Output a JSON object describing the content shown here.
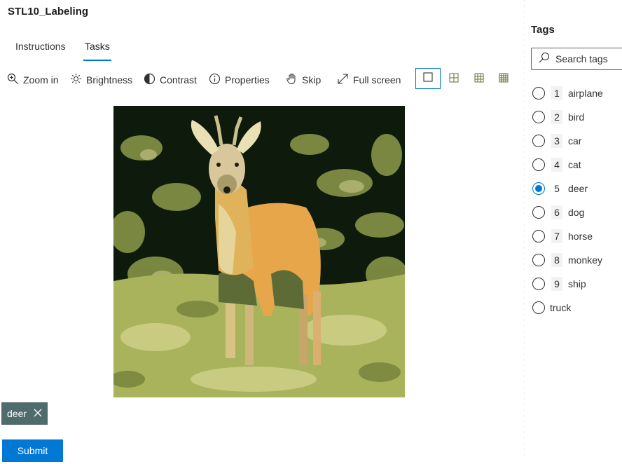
{
  "app": {
    "title": "STL10_Labeling"
  },
  "tabs": [
    {
      "label": "Instructions",
      "active": false
    },
    {
      "label": "Tasks",
      "active": true
    }
  ],
  "toolbar": {
    "zoom_in": "Zoom in",
    "brightness": "Brightness",
    "contrast": "Contrast",
    "properties": "Properties",
    "skip": "Skip",
    "full_screen": "Full screen",
    "grid_options": [
      "single",
      "2x2",
      "3x3",
      "4x4"
    ],
    "grid_selected": "single"
  },
  "image": {
    "subject": "deer"
  },
  "tags_panel": {
    "title": "Tags",
    "search_placeholder": "Search tags",
    "items": [
      {
        "hotkey": "1",
        "label": "airplane",
        "checked": false
      },
      {
        "hotkey": "2",
        "label": "bird",
        "checked": false
      },
      {
        "hotkey": "3",
        "label": "car",
        "checked": false
      },
      {
        "hotkey": "4",
        "label": "cat",
        "checked": false
      },
      {
        "hotkey": "5",
        "label": "deer",
        "checked": true
      },
      {
        "hotkey": "6",
        "label": "dog",
        "checked": false
      },
      {
        "hotkey": "7",
        "label": "horse",
        "checked": false
      },
      {
        "hotkey": "8",
        "label": "monkey",
        "checked": false
      },
      {
        "hotkey": "9",
        "label": "ship",
        "checked": false
      },
      {
        "hotkey": "",
        "label": "truck",
        "checked": false
      }
    ]
  },
  "selected_tag": {
    "label": "deer"
  },
  "actions": {
    "submit": "Submit"
  },
  "colors": {
    "accent": "#0078d4",
    "chip": "#4f6b6b"
  }
}
